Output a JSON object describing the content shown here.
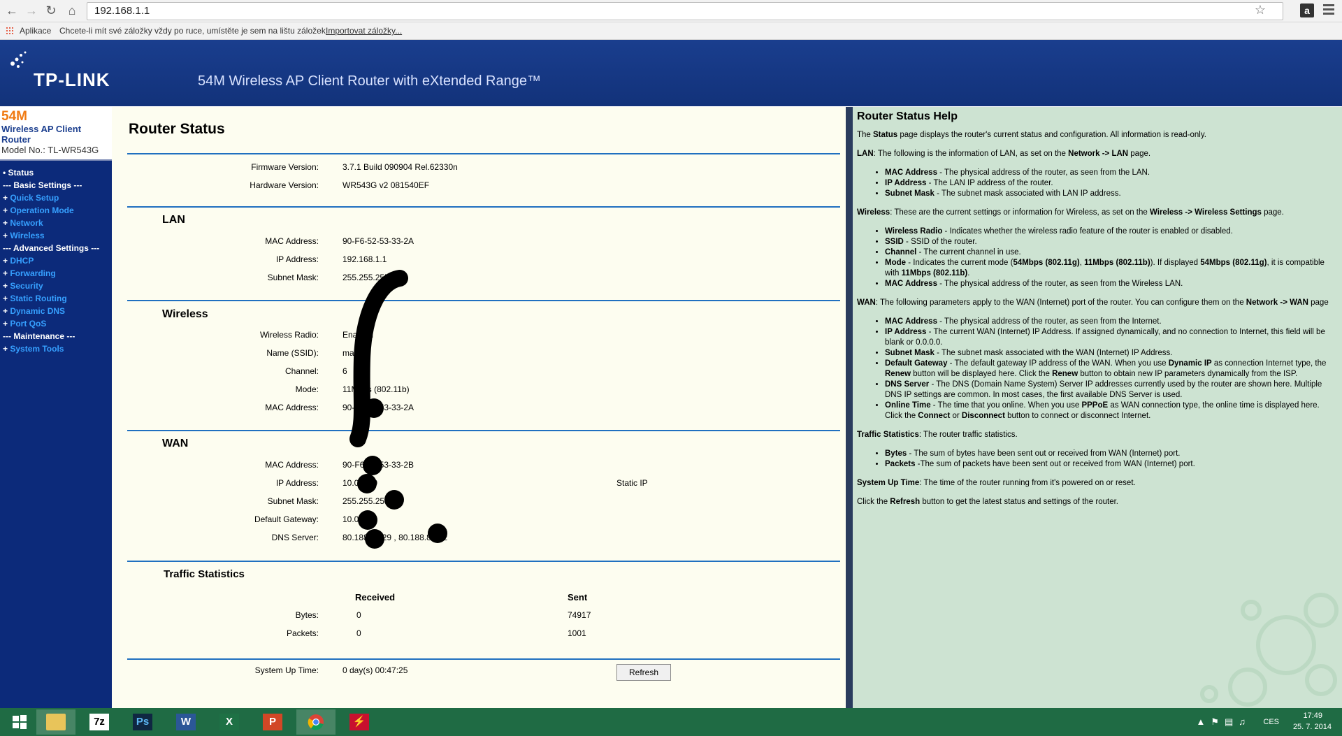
{
  "browser": {
    "url": "192.168.1.1",
    "apps_label": "Aplikace",
    "bookmark_hint": "Chcete-li mít své záložky vždy po ruce, umístěte je sem na lištu záložek.",
    "import_link": "Importovat záložky..."
  },
  "header": {
    "logo": "TP-LINK",
    "title": "54M Wireless AP Client Router with eXtended Range™"
  },
  "sidebar": {
    "model_speed": "54M",
    "model_name": "Wireless AP Client Router",
    "model_no": "Model No.: TL-WR543G",
    "items": [
      {
        "label": "Status"
      },
      {
        "label": "--- Basic Settings ---"
      },
      {
        "label": "Quick Setup"
      },
      {
        "label": "Operation Mode"
      },
      {
        "label": "Network"
      },
      {
        "label": "Wireless"
      },
      {
        "label": "--- Advanced Settings ---"
      },
      {
        "label": "DHCP"
      },
      {
        "label": "Forwarding"
      },
      {
        "label": "Security"
      },
      {
        "label": "Static Routing"
      },
      {
        "label": "Dynamic DNS"
      },
      {
        "label": "Port QoS"
      },
      {
        "label": "--- Maintenance ---"
      },
      {
        "label": "System Tools"
      }
    ]
  },
  "status": {
    "title": "Router Status",
    "firmware_label": "Firmware Version:",
    "firmware_value": "3.7.1 Build 090904 Rel.62330n",
    "hardware_label": "Hardware Version:",
    "hardware_value": "WR543G v2 081540EF",
    "lan": {
      "title": "LAN",
      "mac_label": "MAC Address:",
      "mac_value": "90-F6-52-53-33-2A",
      "ip_label": "IP Address:",
      "ip_value": "192.168.1.1",
      "mask_label": "Subnet Mask:",
      "mask_value": "255.255.255.0"
    },
    "wireless": {
      "title": "Wireless",
      "radio_label": "Wireless Radio:",
      "radio_value": "Enabled",
      "ssid_label": "Name (SSID):",
      "ssid_value": "mamka",
      "channel_label": "Channel:",
      "channel_value": "6",
      "mode_label": "Mode:",
      "mode_value": "11Mbps (802.11b)",
      "mac_label": "MAC Address:",
      "mac_value": "90-F6-52-53-33-2A"
    },
    "wan": {
      "title": "WAN",
      "mac_label": "MAC Address:",
      "mac_value": "90-F6-52-53-33-2B",
      "ip_label": "IP Address:",
      "ip_value": "10.0.0.90",
      "ip_type": "Static IP",
      "mask_label": "Subnet Mask:",
      "mask_value": "255.255.255.0",
      "gw_label": "Default Gateway:",
      "gw_value": "10.0.0.9",
      "dns_label": "DNS Server:",
      "dns_value": "80.188.1.129 , 80.188.8.132"
    },
    "traffic": {
      "title": "Traffic Statistics",
      "received_header": "Received",
      "sent_header": "Sent",
      "bytes_label": "Bytes:",
      "bytes_received": "0",
      "bytes_sent": "74917",
      "packets_label": "Packets:",
      "packets_received": "0",
      "packets_sent": "1001"
    },
    "uptime_label": "System Up Time:",
    "uptime_value": "0 day(s) 00:47:25",
    "refresh_label": "Refresh"
  },
  "help": {
    "title": "Router Status Help"
  },
  "taskbar": {
    "lang": "CES",
    "time": "17:49",
    "date": "25. 7. 2014"
  },
  "colors": {
    "header_blue": "#12327a",
    "nav_blue": "#0c2a7a",
    "link_blue": "#36a0ff",
    "content_bg": "#fdfdf0",
    "help_bg": "#cde3d2",
    "taskbar_green": "#1f6b44"
  }
}
